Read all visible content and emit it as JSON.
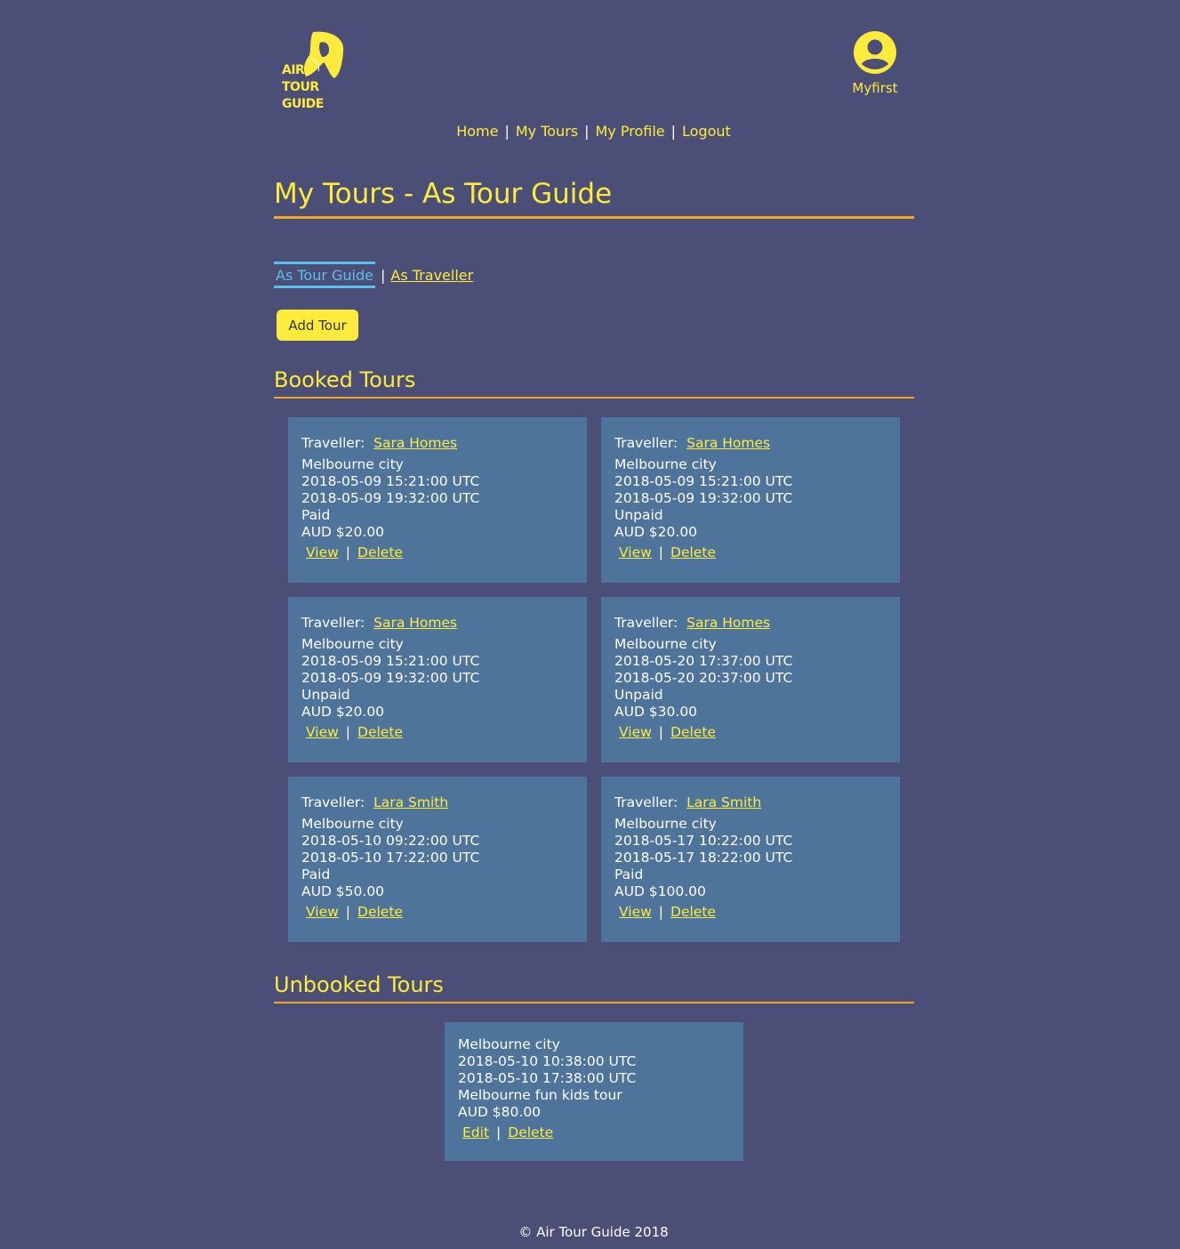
{
  "logo": {
    "text": "AIR\nTOUR\nGUIDE",
    "color": "#ffeb3b"
  },
  "user": {
    "name": "Myfirst",
    "icon": "user-avatar-icon"
  },
  "nav": {
    "home": "Home",
    "my_tours": "My Tours",
    "my_profile": "My Profile",
    "logout": "Logout",
    "separator": "|"
  },
  "page_title": "My Tours - As Tour Guide",
  "subtabs": {
    "as_tour_guide": "As Tour Guide",
    "as_traveller": "As Traveller",
    "separator": "|"
  },
  "add_tour_label": "Add Tour",
  "booked": {
    "title": "Booked Tours",
    "cards": [
      {
        "traveller_label": "Traveller:",
        "traveller": "Sara Homes",
        "location": "Melbourne city",
        "start": "2018-05-09 15:21:00 UTC",
        "end": "2018-05-09 19:32:00 UTC",
        "status": "Paid",
        "price": "AUD $20.00",
        "view": "View",
        "delete": "Delete",
        "sep": "|"
      },
      {
        "traveller_label": "Traveller:",
        "traveller": "Sara Homes",
        "location": "Melbourne city",
        "start": "2018-05-09 15:21:00 UTC",
        "end": "2018-05-09 19:32:00 UTC",
        "status": "Unpaid",
        "price": "AUD $20.00",
        "view": "View",
        "delete": "Delete",
        "sep": "|"
      },
      {
        "traveller_label": "Traveller:",
        "traveller": "Sara Homes",
        "location": "Melbourne city",
        "start": "2018-05-09 15:21:00 UTC",
        "end": "2018-05-09 19:32:00 UTC",
        "status": "Unpaid",
        "price": "AUD $20.00",
        "view": "View",
        "delete": "Delete",
        "sep": "|"
      },
      {
        "traveller_label": "Traveller:",
        "traveller": "Sara Homes",
        "location": "Melbourne city",
        "start": "2018-05-20 17:37:00 UTC",
        "end": "2018-05-20 20:37:00 UTC",
        "status": "Unpaid",
        "price": "AUD $30.00",
        "view": "View",
        "delete": "Delete",
        "sep": "|"
      },
      {
        "traveller_label": "Traveller:",
        "traveller": "Lara Smith",
        "location": "Melbourne city",
        "start": "2018-05-10 09:22:00 UTC",
        "end": "2018-05-10 17:22:00 UTC",
        "status": "Paid",
        "price": "AUD $50.00",
        "view": "View",
        "delete": "Delete",
        "sep": "|"
      },
      {
        "traveller_label": "Traveller:",
        "traveller": "Lara Smith",
        "location": "Melbourne city",
        "start": "2018-05-17 10:22:00 UTC",
        "end": "2018-05-17 18:22:00 UTC",
        "status": "Paid",
        "price": "AUD $100.00",
        "view": "View",
        "delete": "Delete",
        "sep": "|"
      }
    ]
  },
  "unbooked": {
    "title": "Unbooked Tours",
    "cards": [
      {
        "location": "Melbourne city",
        "start": "2018-05-10 10:38:00 UTC",
        "end": "2018-05-10 17:38:00 UTC",
        "name": "Melbourne fun kids tour",
        "price": "AUD $80.00",
        "edit": "Edit",
        "delete": "Delete",
        "sep": "|"
      }
    ]
  },
  "footer": "© Air Tour Guide 2018",
  "colors": {
    "background": "#4b4e77",
    "accent": "#ffeb3b",
    "underline": "#f5a623",
    "card": "#4f749b",
    "active_tab": "#5bc0eb"
  }
}
